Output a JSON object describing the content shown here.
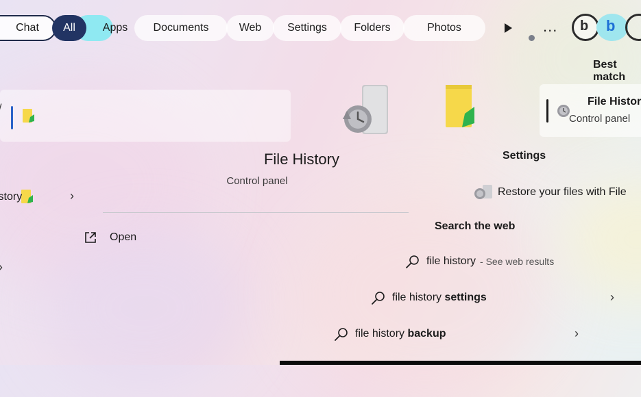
{
  "tabs": {
    "chat": "Chat",
    "all": "All",
    "apps": "Apps",
    "documents": "Documents",
    "web": "Web",
    "settings": "Settings",
    "folders": "Folders",
    "photos": "Photos",
    "more": "...",
    "profile_letter": "b",
    "bing_letter": "b"
  },
  "left_pane": {
    "item_label": "istory"
  },
  "detail": {
    "title": "File History",
    "subtitle": "Control panel",
    "open_label": "Open"
  },
  "results": {
    "best_match_heading": "Best match",
    "best_match_title": "File History",
    "best_match_subtitle": "Control panel",
    "settings_heading": "Settings",
    "settings_item": "Restore your files with File",
    "web_heading": "Search the web",
    "web_items": [
      {
        "query": "file history",
        "suffix": "",
        "hint": "- See web results"
      },
      {
        "query": "file history",
        "suffix": " settings",
        "hint": ""
      },
      {
        "query": "file history",
        "suffix": " backup",
        "hint": ""
      }
    ]
  },
  "colors": {
    "all_tab_bg": "#223463",
    "apps_tab_accent": "#8fe9f2",
    "folder_yellow": "#f6d84a",
    "clock_green": "#2fb34e"
  }
}
